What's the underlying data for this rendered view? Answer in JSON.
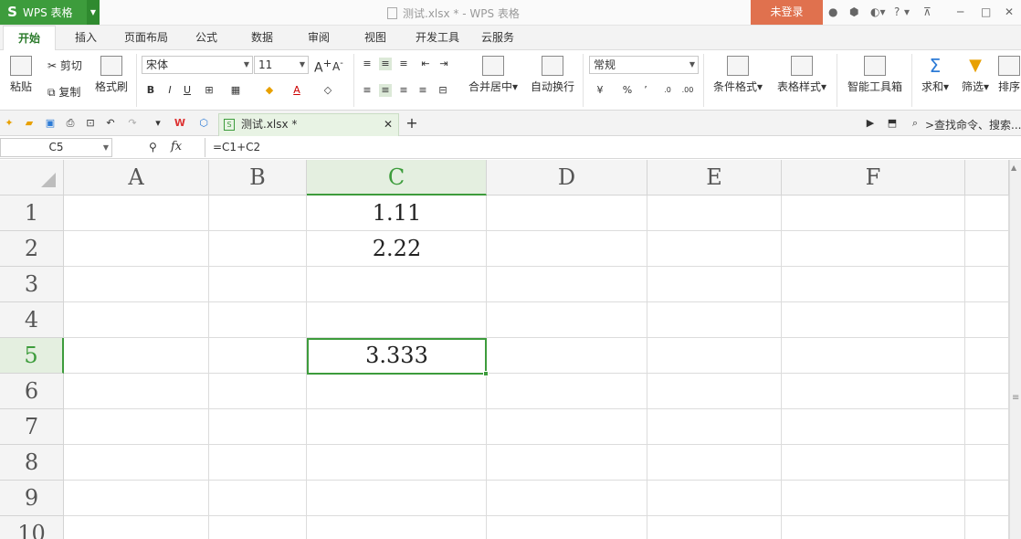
{
  "titlebar": {
    "app_logo": "S",
    "app_name": "WPS 表格",
    "window_title": "测试.xlsx * - WPS 表格",
    "login": "未登录",
    "help": "?"
  },
  "tabs": [
    "开始",
    "插入",
    "页面布局",
    "公式",
    "数据",
    "审阅",
    "视图",
    "开发工具",
    "云服务"
  ],
  "ribbon": {
    "cut": "剪切",
    "paste": "粘贴",
    "copy": "复制",
    "format_painter": "格式刷",
    "font_name": "宋体",
    "font_size": "11",
    "bold": "B",
    "italic": "I",
    "underline": "U",
    "merge_center": "合并居中",
    "wrap_text": "自动换行",
    "number_format": "常规",
    "percent": "%",
    "comma": "’",
    "cond_format": "条件格式",
    "table_style": "表格样式",
    "smart_toolbox": "智能工具箱",
    "sum": "求和",
    "filter": "筛选",
    "sort": "排序"
  },
  "quick_access": {
    "doc_tab": "测试.xlsx *",
    "search": ">查找命令、搜索..."
  },
  "formula_bar": {
    "name_box": "C5",
    "fx": "fx",
    "formula": "=C1+C2"
  },
  "sheet": {
    "columns": [
      "A",
      "B",
      "C",
      "D",
      "E",
      "F"
    ],
    "rows": [
      "1",
      "2",
      "3",
      "4",
      "5",
      "6",
      "7",
      "8",
      "9",
      "10"
    ],
    "cells": {
      "C1": "1.11",
      "C2": "2.22",
      "C5": "3.333"
    },
    "active_cell": "C5"
  },
  "colors": {
    "accent": "#3d9c3c",
    "login_bg": "#e0714e"
  }
}
